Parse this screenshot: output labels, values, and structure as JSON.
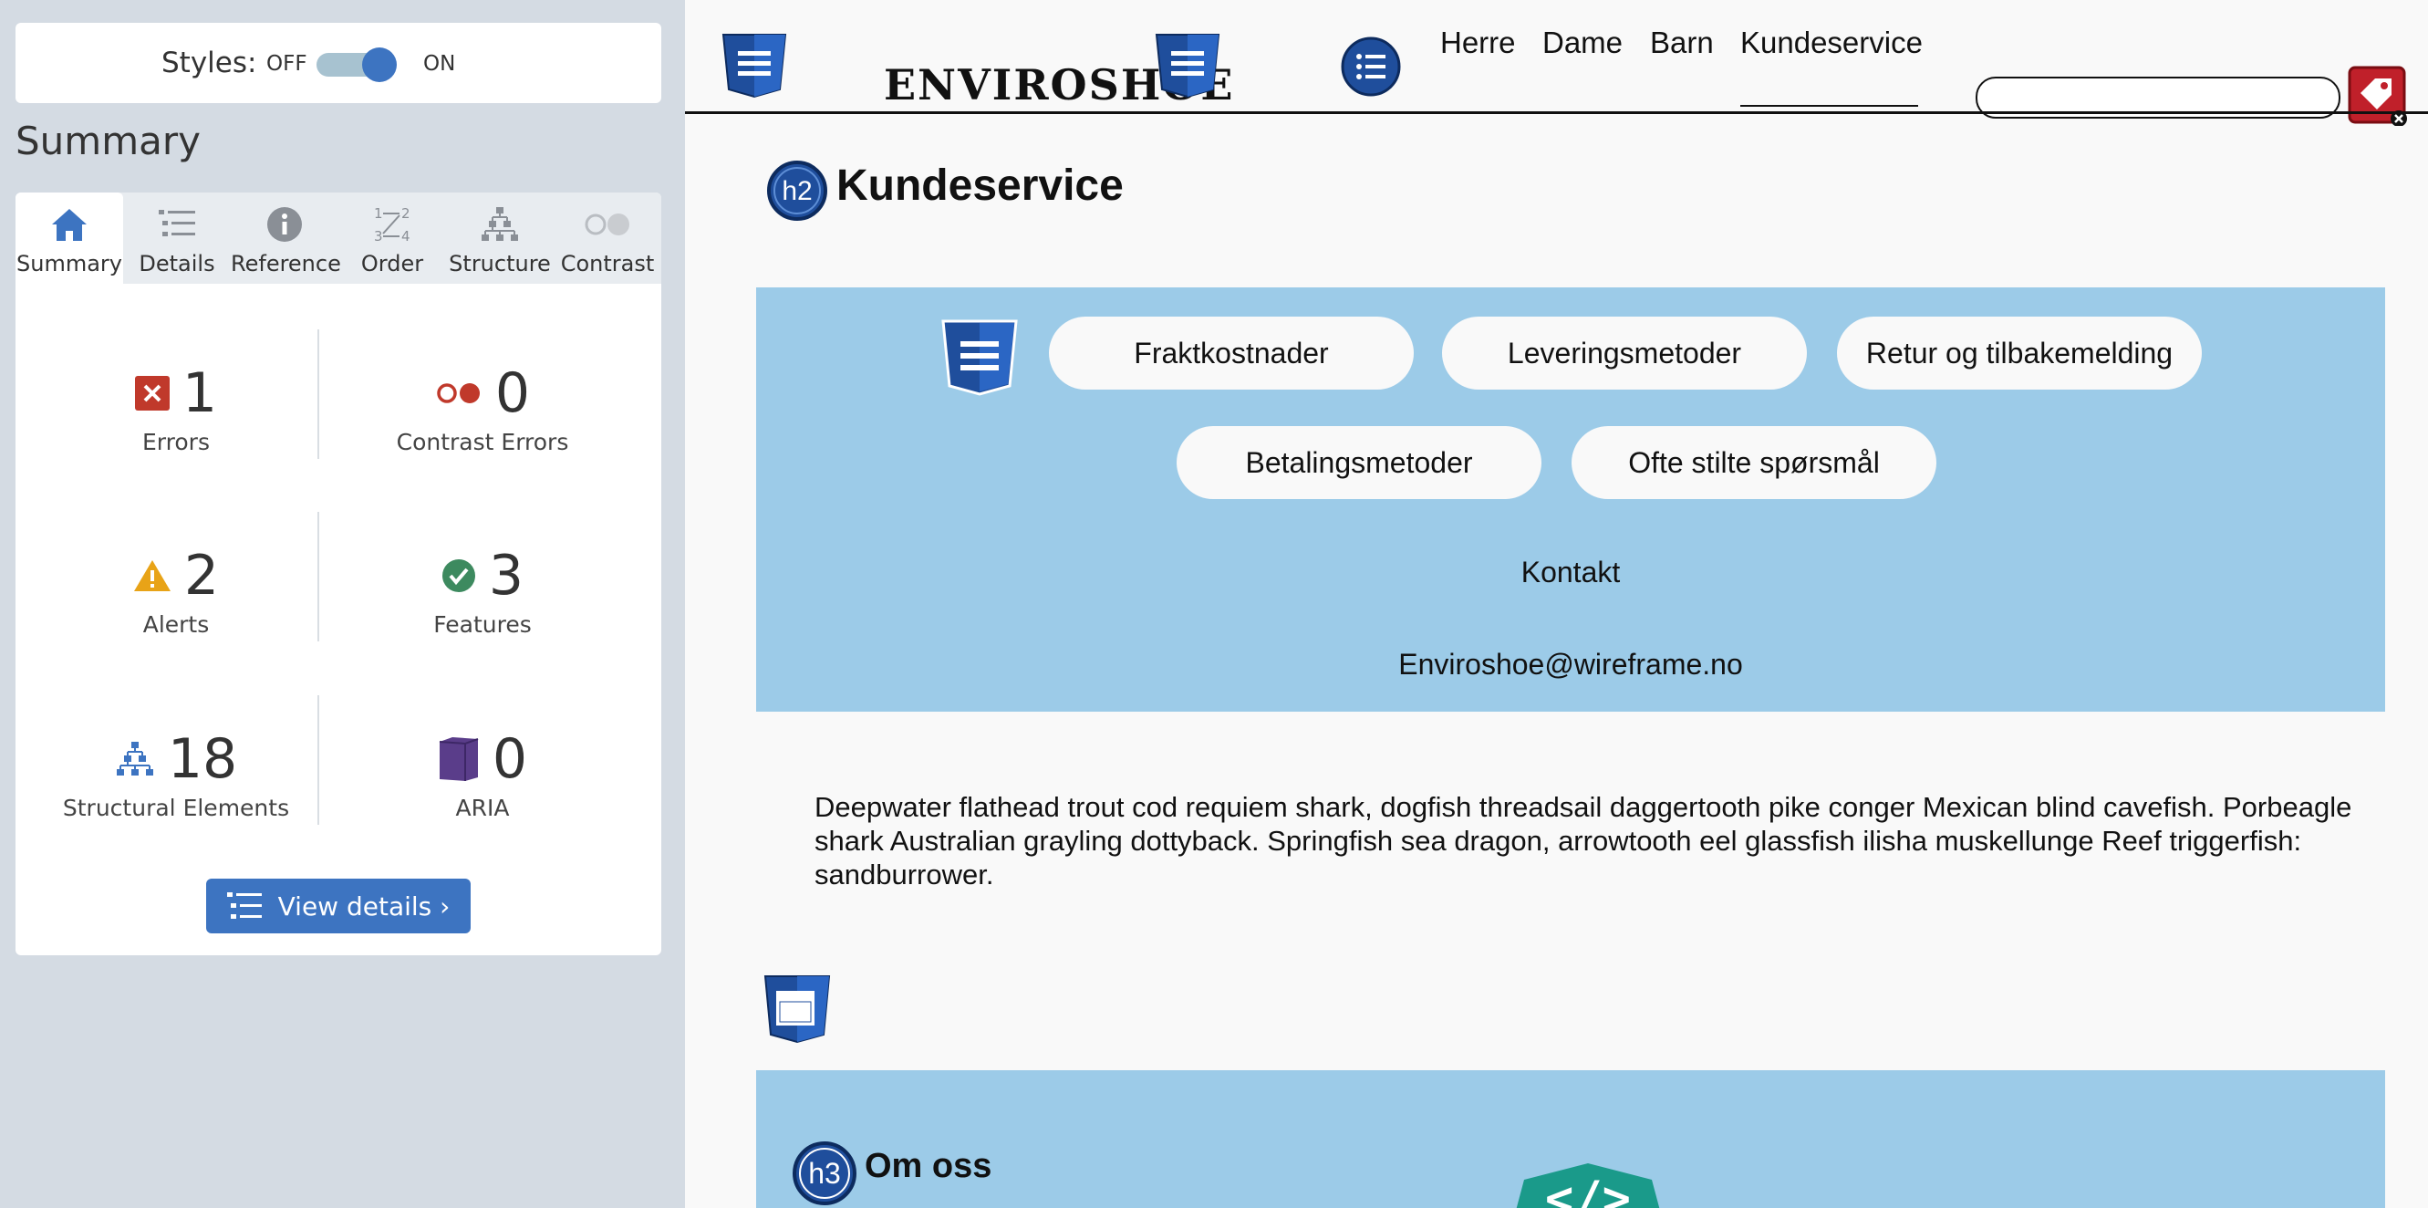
{
  "panel": {
    "styles_label": "Styles:",
    "toggle_off": "OFF",
    "toggle_on": "ON",
    "toggle_state": "on",
    "summary_heading": "Summary",
    "tabs": [
      {
        "label": "Summary",
        "icon": "home-icon",
        "active": true
      },
      {
        "label": "Details",
        "icon": "list-icon"
      },
      {
        "label": "Reference",
        "icon": "info-icon"
      },
      {
        "label": "Order",
        "icon": "order-icon"
      },
      {
        "label": "Structure",
        "icon": "hierarchy-icon"
      },
      {
        "label": "Contrast",
        "icon": "contrast-icon"
      }
    ],
    "stats": {
      "errors": {
        "count": "1",
        "label": "Errors",
        "icon": "error-x-icon"
      },
      "contrast_errors": {
        "count": "0",
        "label": "Contrast Errors",
        "icon": "contrast-error-icon"
      },
      "alerts": {
        "count": "2",
        "label": "Alerts",
        "icon": "alert-triangle-icon"
      },
      "features": {
        "count": "3",
        "label": "Features",
        "icon": "check-circle-icon"
      },
      "structural": {
        "count": "18",
        "label": "Structural Elements",
        "icon": "hierarchy-icon"
      },
      "aria": {
        "count": "0",
        "label": "ARIA",
        "icon": "aria-cube-icon"
      }
    },
    "view_details": "View details ›"
  },
  "site": {
    "logo": "ENVIROSHOE",
    "nav": [
      "Herre",
      "Dame",
      "Barn",
      "Kundeservice"
    ],
    "active_nav": "Kundeservice",
    "search_placeholder": "",
    "h2_badge": "h2",
    "heading": "Kundeservice",
    "buttons": [
      "Fraktkostnader",
      "Leveringsmetoder",
      "Retur og tilbakemelding",
      "Betalingsmetoder",
      "Ofte stilte spørsmål"
    ],
    "contact_label": "Kontakt",
    "email": "Enviroshoe@wireframe.no",
    "paragraph": "Deepwater flathead trout cod requiem shark, dogfish threadsail daggertooth pike conger Mexican blind cavefish. Porbeagle shark Australian grayling dottyback. Springfish sea dragon, arrowtooth eel glassfish ilisha muskellunge Reef triggerfish: sandburrower.",
    "h3_badge": "h3",
    "subheading": "Om oss",
    "code_badge": "</>"
  },
  "colors": {
    "accent": "#3d74c1",
    "panel_bg": "#d4dbe3",
    "section_blue": "#9ccbe8",
    "error_red": "#c0392b",
    "alert_orange": "#e8a317",
    "feature_green": "#3d8a5f",
    "aria_purple": "#5a3d8a",
    "badge_navy": "#1f4e9c",
    "code_teal": "#1a9a8a"
  }
}
